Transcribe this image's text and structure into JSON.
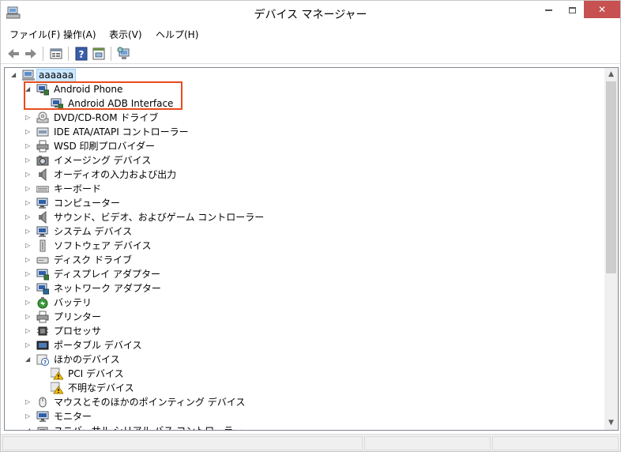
{
  "window": {
    "title": "デバイス マネージャー"
  },
  "menu": {
    "items": [
      "ファイル(F)",
      "操作(A)",
      "表示(V)",
      "ヘルプ(H)"
    ]
  },
  "toolbar": {
    "buttons": [
      "back-arrow-icon",
      "forward-arrow-icon",
      "properties-icon",
      "help-icon",
      "show-hidden-icon",
      "scan-hardware-icon"
    ]
  },
  "tree": {
    "root": "aaaaaa",
    "items": [
      {
        "label": "Android Phone",
        "icon": "android-phone-icon",
        "level": 1,
        "state": "expanded"
      },
      {
        "label": "Android ADB Interface",
        "icon": "adb-interface-icon",
        "level": 2,
        "state": "leaf"
      },
      {
        "label": "DVD/CD-ROM ドライブ",
        "icon": "dvd-drive-icon",
        "level": 1,
        "state": "collapsed"
      },
      {
        "label": "IDE ATA/ATAPI コントローラー",
        "icon": "ide-controller-icon",
        "level": 1,
        "state": "collapsed"
      },
      {
        "label": "WSD 印刷プロバイダー",
        "icon": "printer-icon",
        "level": 1,
        "state": "collapsed"
      },
      {
        "label": "イメージング デバイス",
        "icon": "camera-icon",
        "level": 1,
        "state": "collapsed"
      },
      {
        "label": "オーディオの入力および出力",
        "icon": "speaker-icon",
        "level": 1,
        "state": "collapsed"
      },
      {
        "label": "キーボード",
        "icon": "keyboard-icon",
        "level": 1,
        "state": "collapsed"
      },
      {
        "label": "コンピューター",
        "icon": "computer-icon",
        "level": 1,
        "state": "collapsed"
      },
      {
        "label": "サウンド、ビデオ、およびゲーム コントローラー",
        "icon": "speaker-icon",
        "level": 1,
        "state": "collapsed"
      },
      {
        "label": "システム デバイス",
        "icon": "computer-icon",
        "level": 1,
        "state": "collapsed"
      },
      {
        "label": "ソフトウェア デバイス",
        "icon": "software-device-icon",
        "level": 1,
        "state": "collapsed"
      },
      {
        "label": "ディスク ドライブ",
        "icon": "disk-drive-icon",
        "level": 1,
        "state": "collapsed"
      },
      {
        "label": "ディスプレイ アダプター",
        "icon": "display-adapter-icon",
        "level": 1,
        "state": "collapsed"
      },
      {
        "label": "ネットワーク アダプター",
        "icon": "network-adapter-icon",
        "level": 1,
        "state": "collapsed"
      },
      {
        "label": "バッテリ",
        "icon": "battery-icon",
        "level": 1,
        "state": "collapsed"
      },
      {
        "label": "プリンター",
        "icon": "printer-icon",
        "level": 1,
        "state": "collapsed"
      },
      {
        "label": "プロセッサ",
        "icon": "processor-icon",
        "level": 1,
        "state": "collapsed"
      },
      {
        "label": "ポータブル デバイス",
        "icon": "portable-device-icon",
        "level": 1,
        "state": "collapsed"
      },
      {
        "label": "ほかのデバイス",
        "icon": "unknown-device-icon",
        "level": 1,
        "state": "expanded"
      },
      {
        "label": "PCI デバイス",
        "icon": "warning-device-icon",
        "level": 2,
        "state": "leaf"
      },
      {
        "label": "不明なデバイス",
        "icon": "warning-device-icon",
        "level": 2,
        "state": "leaf"
      },
      {
        "label": "マウスとそのほかのポインティング デバイス",
        "icon": "mouse-icon",
        "level": 1,
        "state": "collapsed"
      },
      {
        "label": "モニター",
        "icon": "monitor-icon",
        "level": 1,
        "state": "collapsed"
      },
      {
        "label": "ユニバーサル シリアル バス コントローラー",
        "icon": "usb-controller-icon",
        "level": 1,
        "state": "expanded"
      }
    ]
  },
  "colors": {
    "highlight_box": "#ea4b1e",
    "selection": "#cce8ff",
    "close_button": "#c75050"
  }
}
